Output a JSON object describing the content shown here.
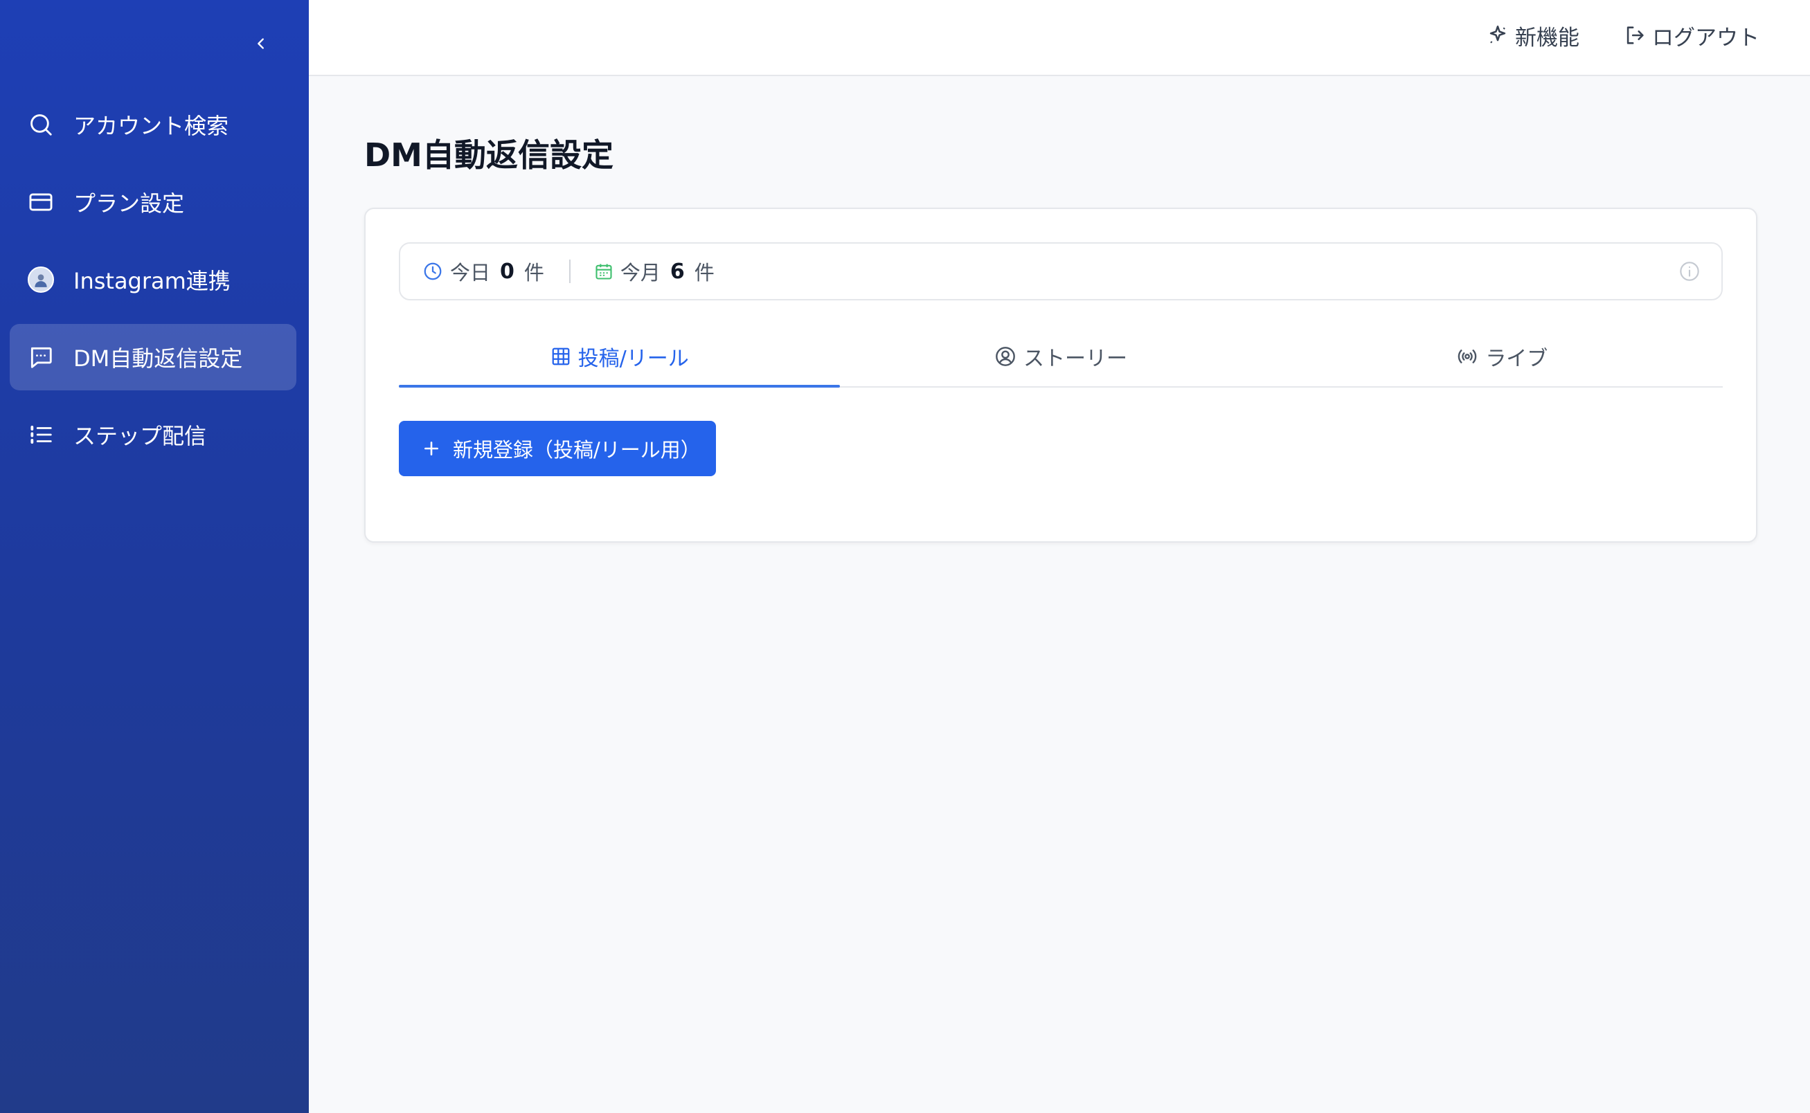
{
  "sidebar": {
    "items": [
      {
        "label": "アカウント検索",
        "icon": "search-icon"
      },
      {
        "label": "プラン設定",
        "icon": "credit-card-icon"
      },
      {
        "label": "Instagram連携",
        "icon": "avatar-icon"
      },
      {
        "label": "DM自動返信設定",
        "icon": "message-icon",
        "active": true
      },
      {
        "label": "ステップ配信",
        "icon": "list-icon"
      }
    ]
  },
  "topbar": {
    "new_features_label": "新機能",
    "logout_label": "ログアウト"
  },
  "page": {
    "title": "DM自動返信設定"
  },
  "stats": {
    "today_label": "今日",
    "today_count": "0",
    "month_label": "今月",
    "month_count": "6",
    "unit": "件"
  },
  "tabs": [
    {
      "label": "投稿/リール",
      "icon": "grid-icon",
      "active": true
    },
    {
      "label": "ストーリー",
      "icon": "user-circle-icon",
      "active": false
    },
    {
      "label": "ライブ",
      "icon": "broadcast-icon",
      "active": false
    }
  ],
  "actions": {
    "new_button_label": "新規登録（投稿/リール用）"
  },
  "colors": {
    "sidebar": "#1e3fb5",
    "accent": "#2563eb",
    "background": "#f8f9fb"
  }
}
